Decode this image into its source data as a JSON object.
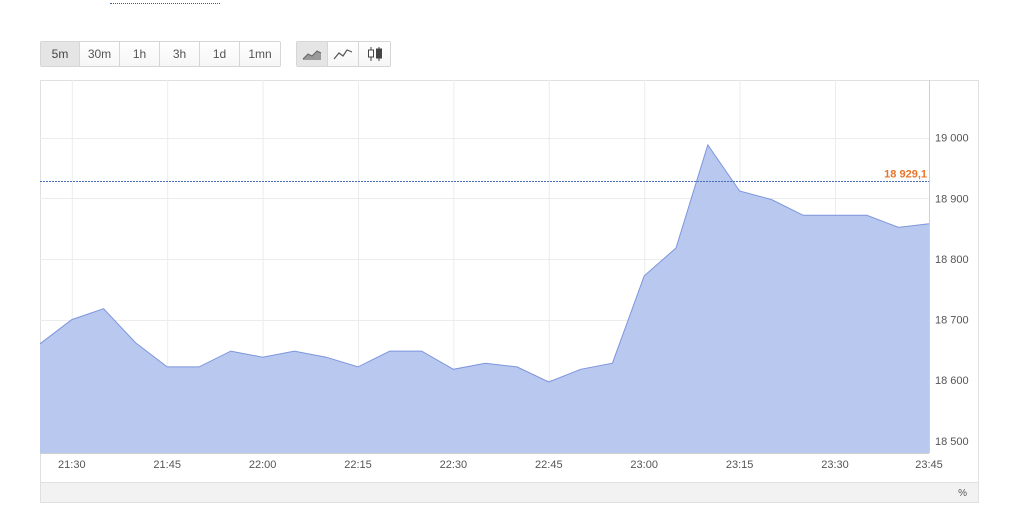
{
  "toolbar": {
    "ranges": [
      "5m",
      "30m",
      "1h",
      "3h",
      "1d",
      "1mn"
    ],
    "active_range": "5m",
    "chart_types": [
      "area-chart-icon",
      "line-chart-icon",
      "candlestick-icon"
    ],
    "active_type": "area-chart-icon"
  },
  "colors": {
    "area_fill": "#b9c8ef",
    "area_line": "#7d95dc",
    "reference_line": "#4a6fb8",
    "reference_label": "#e8752a",
    "grid": "#ececec",
    "axis_text": "#555555"
  },
  "footer": {
    "percent_label": "%"
  },
  "chart_data": {
    "type": "area",
    "x": [
      "21:25",
      "21:30",
      "21:35",
      "21:40",
      "21:45",
      "21:50",
      "21:55",
      "22:00",
      "22:05",
      "22:10",
      "22:15",
      "22:20",
      "22:25",
      "22:30",
      "22:35",
      "22:40",
      "22:45",
      "22:50",
      "22:55",
      "23:00",
      "23:05",
      "23:10",
      "23:15",
      "23:20",
      "23:25",
      "23:30",
      "23:35",
      "23:40",
      "23:45",
      "23:46"
    ],
    "values": [
      18660,
      18700,
      18718,
      18662,
      18622,
      18622,
      18648,
      18638,
      18648,
      18638,
      18622,
      18648,
      18648,
      18618,
      18628,
      18622,
      18597,
      18618,
      18628,
      18772,
      18818,
      18988,
      18912,
      18898,
      18872,
      18872,
      18872,
      18852,
      18858,
      18858
    ],
    "xticks": [
      "21:30",
      "21:45",
      "22:00",
      "22:15",
      "22:30",
      "22:45",
      "23:00",
      "23:15",
      "23:30",
      "23:45"
    ],
    "yticks": [
      18500,
      18600,
      18700,
      18800,
      18900,
      19000
    ],
    "ytick_labels": [
      "18 500",
      "18 600",
      "18 700",
      "18 800",
      "18 900",
      "19 000"
    ],
    "ylim": [
      18480,
      19095
    ],
    "reference": {
      "value": 18929.1,
      "label": "18 929,1"
    },
    "grid": true,
    "title": "",
    "xlabel": "",
    "ylabel": ""
  }
}
